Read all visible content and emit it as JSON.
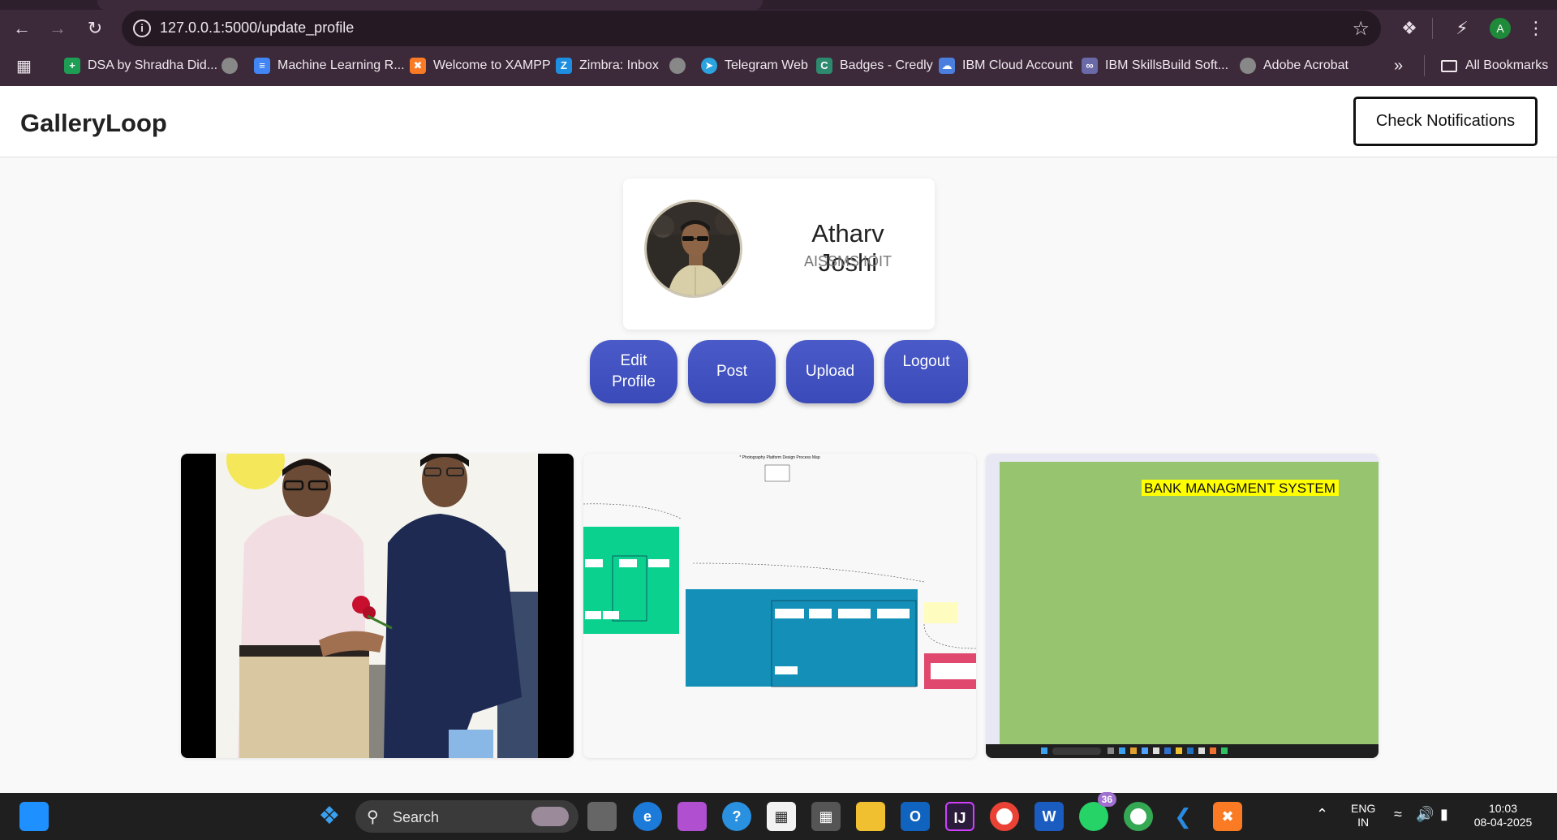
{
  "browser": {
    "url": "127.0.0.1:5000/update_profile",
    "profile_initial": "A",
    "bookmarks": [
      {
        "label": "DSA by Shradha Did...",
        "icon": "google-sheets-icon",
        "color": "#1e9e55"
      },
      {
        "label": "",
        "icon": "globe-icon",
        "color": "#888"
      },
      {
        "label": "Machine Learning R...",
        "icon": "google-docs-icon",
        "color": "#4285f4"
      },
      {
        "label": "Welcome to XAMPP",
        "icon": "xampp-icon",
        "color": "#fb7a24"
      },
      {
        "label": "Zimbra: Inbox",
        "icon": "zimbra-icon",
        "color": "#1d8ee0"
      },
      {
        "label": "",
        "icon": "globe-icon",
        "color": "#888"
      },
      {
        "label": "Telegram Web",
        "icon": "telegram-icon",
        "color": "#2aa3e0"
      },
      {
        "label": "Badges - Credly",
        "icon": "credly-icon",
        "color": "#2d8a6e"
      },
      {
        "label": "IBM Cloud Account",
        "icon": "ibm-cloud-icon",
        "color": "#4a7fe0"
      },
      {
        "label": "IBM SkillsBuild Soft...",
        "icon": "ibm-skillsbuild-icon",
        "color": "#6a6aa8"
      },
      {
        "label": "Adobe Acrobat",
        "icon": "globe-icon",
        "color": "#888"
      }
    ],
    "overflow": "»",
    "all_bookmarks": "All Bookmarks"
  },
  "app": {
    "brand": "GalleryLoop",
    "notify_label": "Check Notifications",
    "profile": {
      "name": "Atharv Joshi",
      "college": "AISSMS IOIT"
    },
    "actions": {
      "edit_label": "Edit Profile",
      "post_label": "Post",
      "upload_label": "Upload",
      "logout_label": "Logout"
    },
    "gallery": [
      {
        "type": "photo"
      },
      {
        "type": "diagram",
        "heading": "* Photography Platform Design Process Map"
      },
      {
        "type": "screenshot",
        "title": "BANK MANAGMENT SYSTEM"
      }
    ]
  },
  "taskbar": {
    "search_label": "Search",
    "whatsapp_badge": "36",
    "lang_line1": "ENG",
    "lang_line2": "IN",
    "time": "10:03",
    "date": "08-04-2025"
  }
}
